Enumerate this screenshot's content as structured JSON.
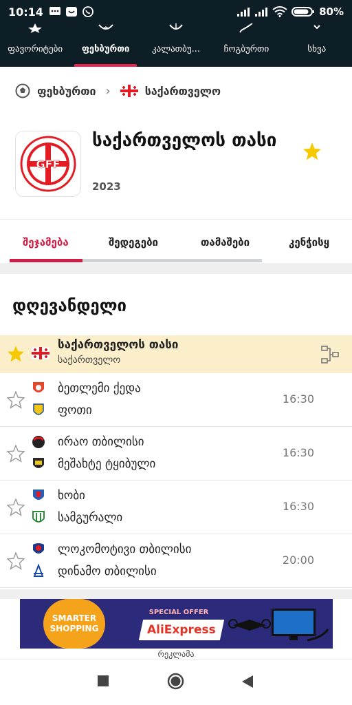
{
  "status_bar": {
    "time": "10:14",
    "battery": "80%"
  },
  "top_nav": {
    "tabs": [
      {
        "label": "ფავორიტები",
        "icon": "star-icon"
      },
      {
        "label": "ფეხბურთი",
        "icon": "soccer-ball-icon",
        "active": true
      },
      {
        "label": "კალათბუ...",
        "icon": "basketball-icon"
      },
      {
        "label": "ჩოგბურთი",
        "icon": "tennis-icon"
      },
      {
        "label": "სხვა",
        "icon": "chevron-down-icon"
      }
    ]
  },
  "breadcrumb": {
    "sport": "ფეხბურთი",
    "country": "საქართველო"
  },
  "league": {
    "title": "საქართველოს თასი",
    "year": "2023",
    "logo_text": "GFF"
  },
  "sub_tabs": [
    "შეჯამება",
    "შედეგები",
    "თამაშები",
    "კენჭისყ"
  ],
  "section_title": "დღევანდელი",
  "competition": {
    "name": "საქართველოს თასი",
    "country": "საქართველო"
  },
  "matches": [
    {
      "home": "ბეთლემი ქედა",
      "away": "ფოთი",
      "time": "16:30"
    },
    {
      "home": "ირაო თბილისი",
      "away": "მეშახტე ტყიბული",
      "time": "16:30"
    },
    {
      "home": "ხობი",
      "away": "სამგურალი",
      "time": "16:30"
    },
    {
      "home": "ლოკომოტივი თბილისი",
      "away": "დინამო თბილისი",
      "time": "20:00"
    }
  ],
  "ad": {
    "badge": "SMARTER SHOPPING",
    "offer": "SPECIAL OFFER",
    "brand": "AliExpress",
    "label": "რეკლამა"
  },
  "colors": {
    "header_bg": "#0e1e26",
    "accent": "#d01d45",
    "star": "#f5c800",
    "highlight_row": "#fbefcb"
  }
}
